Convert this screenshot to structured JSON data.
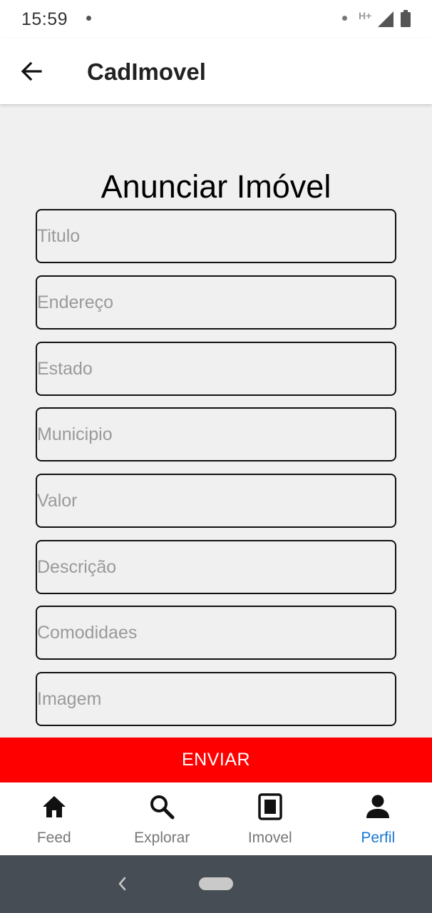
{
  "status_bar": {
    "time": "15:59",
    "network": "H+"
  },
  "app_bar": {
    "title": "CadImovel",
    "back_icon": "arrow-left-icon"
  },
  "form": {
    "heading": "Anunciar Imóvel",
    "fields": [
      {
        "name": "titulo",
        "placeholder": "Titulo",
        "value": ""
      },
      {
        "name": "endereco",
        "placeholder": "Endereço",
        "value": ""
      },
      {
        "name": "estado",
        "placeholder": "Estado",
        "value": ""
      },
      {
        "name": "municipio",
        "placeholder": "Municipio",
        "value": ""
      },
      {
        "name": "valor",
        "placeholder": "Valor",
        "value": ""
      },
      {
        "name": "descricao",
        "placeholder": "Descrição",
        "value": ""
      },
      {
        "name": "comodidades",
        "placeholder": "Comodidaes",
        "value": ""
      },
      {
        "name": "imagem",
        "placeholder": "Imagem",
        "value": ""
      }
    ],
    "submit_label": "ENVIAR",
    "submit_color": "#ff0000"
  },
  "bottom_nav": {
    "items": [
      {
        "label": "Feed",
        "icon": "home-icon",
        "active": false
      },
      {
        "label": "Explorar",
        "icon": "search-icon",
        "active": false
      },
      {
        "label": "Imovel",
        "icon": "document-icon",
        "active": false
      },
      {
        "label": "Perfil",
        "icon": "person-icon",
        "active": true
      }
    ],
    "active_color": "#1976d2"
  }
}
